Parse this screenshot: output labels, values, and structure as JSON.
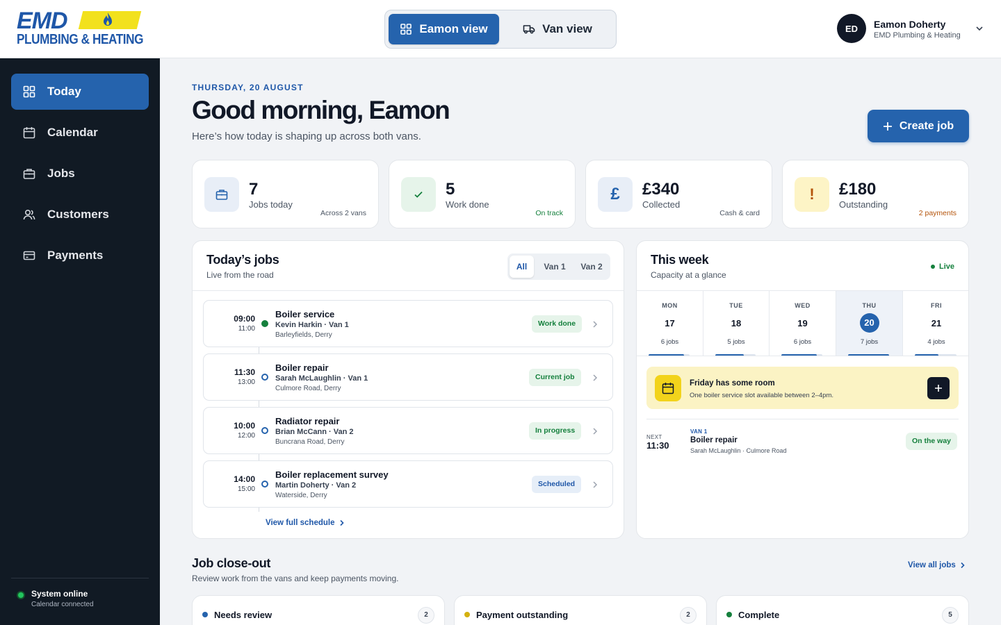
{
  "header": {
    "logo": {
      "top": "EMD",
      "bottom": "PLUMBING & HEATING"
    },
    "views": [
      {
        "label": "Eamon view",
        "icon": "grid-icon",
        "active": true
      },
      {
        "label": "Van view",
        "icon": "van-icon",
        "active": false
      }
    ],
    "user": {
      "initials": "ED",
      "name": "Eamon Doherty",
      "org": "EMD Plumbing & Heating"
    }
  },
  "sidebar": {
    "items": [
      {
        "label": "Today",
        "icon": "grid-icon",
        "active": true
      },
      {
        "label": "Calendar",
        "icon": "calendar-icon",
        "active": false
      },
      {
        "label": "Jobs",
        "icon": "briefcase-icon",
        "active": false
      },
      {
        "label": "Customers",
        "icon": "users-icon",
        "active": false
      },
      {
        "label": "Payments",
        "icon": "card-icon",
        "active": false
      }
    ],
    "status": {
      "title": "System online",
      "subtitle": "Calendar connected"
    }
  },
  "page": {
    "date": "THURSDAY, 20 AUGUST",
    "greeting": "Good morning, Eamon",
    "subtitle": "Here’s how today is shaping up across both vans.",
    "create_label": "Create job"
  },
  "stats": [
    {
      "value": "7",
      "label": "Jobs today",
      "note": "Across 2 vans",
      "icon": "briefcase-icon",
      "icon_bg": "#e8eef7",
      "icon_color": "#2563ad",
      "note_color": "#4b5563"
    },
    {
      "value": "5",
      "label": "Work done",
      "note": "On track",
      "icon": "check-icon",
      "icon_bg": "#e6f4ea",
      "icon_color": "#15803d",
      "note_color": "#15803d"
    },
    {
      "value": "£340",
      "label": "Collected",
      "note": "Cash & card",
      "icon": "pound-icon",
      "icon_bg": "#e8eef7",
      "icon_color": "#2563ad",
      "note_color": "#4b5563"
    },
    {
      "value": "£180",
      "label": "Outstanding",
      "note": "2 payments",
      "icon": "alert-icon",
      "icon_bg": "#fdf4c6",
      "icon_color": "#b45309",
      "note_color": "#b45309"
    }
  ],
  "today_jobs": {
    "title": "Today’s jobs",
    "subtitle": "Live from the road",
    "filters": [
      "All",
      "Van 1",
      "Van 2"
    ],
    "active_filter": "All",
    "jobs": [
      {
        "start": "09:00",
        "end": "11:00",
        "title": "Boiler service",
        "meta": "Kevin Harkin · Van 1",
        "address": "Barleyfields, Derry",
        "status": "Work done",
        "tone": "green",
        "dot": "done"
      },
      {
        "start": "11:30",
        "end": "13:00",
        "title": "Boiler repair",
        "meta": "Sarah McLaughlin · Van 1",
        "address": "Culmore Road, Derry",
        "status": "Current job",
        "tone": "green",
        "dot": "open"
      },
      {
        "start": "10:00",
        "end": "12:00",
        "title": "Radiator repair",
        "meta": "Brian McCann · Van 2",
        "address": "Buncrana Road, Derry",
        "status": "In progress",
        "tone": "green",
        "dot": "open"
      },
      {
        "start": "14:00",
        "end": "15:00",
        "title": "Boiler replacement survey",
        "meta": "Martin Doherty · Van 2",
        "address": "Waterside, Derry",
        "status": "Scheduled",
        "tone": "blue",
        "dot": "open"
      }
    ],
    "view_all": "View full schedule"
  },
  "week": {
    "title": "This week",
    "subtitle": "Capacity at a glance",
    "live_label": "Live",
    "days": [
      {
        "name": "MON",
        "date": "17",
        "jobs": "6 jobs",
        "capacity": 0.86,
        "today": false
      },
      {
        "name": "TUE",
        "date": "18",
        "jobs": "5 jobs",
        "capacity": 0.71,
        "today": false
      },
      {
        "name": "WED",
        "date": "19",
        "jobs": "6 jobs",
        "capacity": 0.86,
        "today": false
      },
      {
        "name": "THU",
        "date": "20",
        "jobs": "7 jobs",
        "capacity": 1.0,
        "today": true
      },
      {
        "name": "FRI",
        "date": "21",
        "jobs": "4 jobs",
        "capacity": 0.57,
        "today": false
      }
    ],
    "notice": {
      "title": "Friday has some room",
      "text": "One boiler service slot available between 2–4pm."
    },
    "next": {
      "label": "NEXT",
      "time": "11:30",
      "van": "VAN 1",
      "title": "Boiler repair",
      "meta": "Sarah McLaughlin · Culmore Road",
      "status": "On the way"
    }
  },
  "closeout": {
    "title": "Job close-out",
    "subtitle": "Review work from the vans and keep payments moving.",
    "view_all": "View all jobs",
    "buckets": [
      {
        "label": "Needs review",
        "count": "2",
        "color": "#2563ad"
      },
      {
        "label": "Payment outstanding",
        "count": "2",
        "color": "#d4b10e"
      },
      {
        "label": "Complete",
        "count": "5",
        "color": "#15803d"
      }
    ]
  }
}
